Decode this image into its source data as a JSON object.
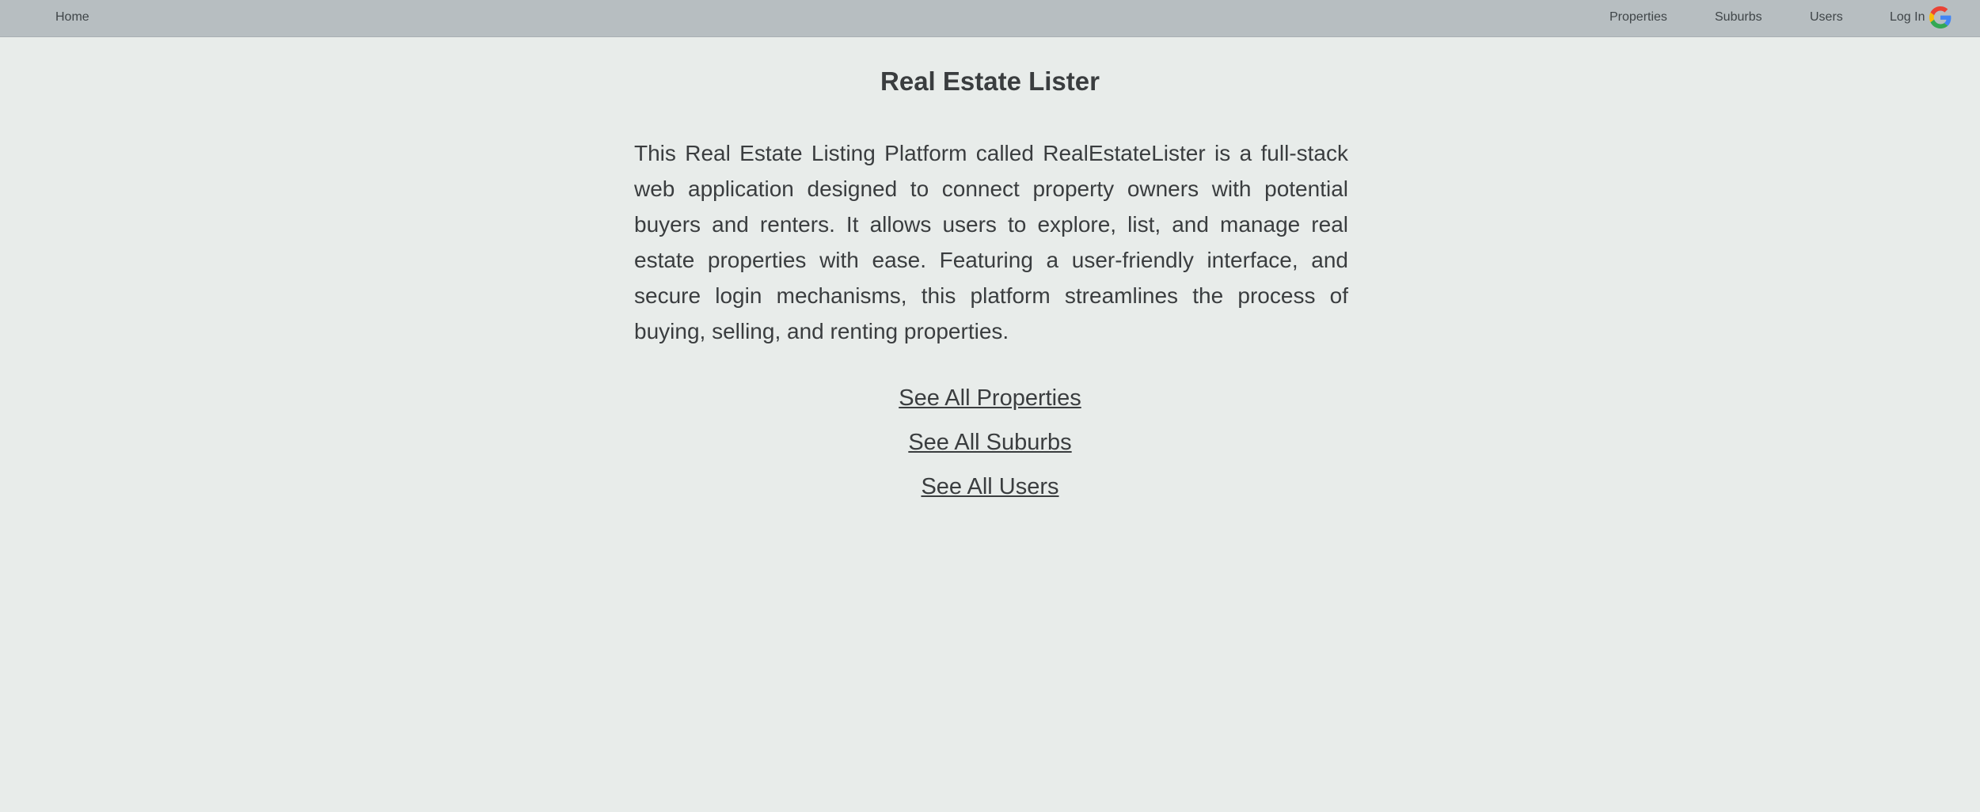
{
  "nav": {
    "home": "Home",
    "properties": "Properties",
    "suburbs": "Suburbs",
    "users": "Users",
    "login": "Log In",
    "login_icon": "google-icon"
  },
  "main": {
    "title": "Real Estate Lister",
    "description": "This Real Estate Listing Platform called RealEstateLister is a full-stack web application designed to connect property owners with potential buyers and renters. It allows users to explore, list, and manage real estate properties with ease. Featuring a user-friendly interface, and secure login mechanisms, this platform streamlines the process of buying, selling, and renting properties.",
    "links": {
      "properties": "See All Properties",
      "suburbs": "See All Suburbs",
      "users": "See All Users"
    }
  },
  "colors": {
    "navbar_bg": "#b7bec1",
    "page_bg": "#e8ecea",
    "text": "#3a3d3f"
  }
}
